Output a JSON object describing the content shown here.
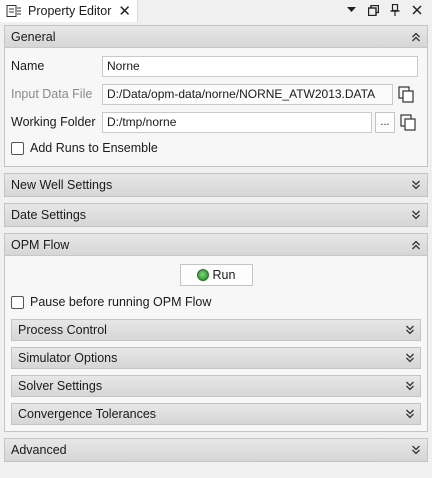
{
  "window": {
    "tab_title": "Property Editor",
    "close_glyph": "✕",
    "icons": [
      "property-editor-icon",
      "tab-close-icon",
      "dropdown-icon",
      "restore-icon",
      "pin-icon",
      "window-close-icon"
    ]
  },
  "sections": {
    "general": {
      "title": "General",
      "name_label": "Name",
      "name_value": "Norne",
      "input_label": "Input Data File",
      "input_value": "D:/Data/opm-data/norne/NORNE_ATW2013.DATA",
      "working_label": "Working Folder",
      "working_value": "D:/tmp/norne",
      "browse_label": "...",
      "add_runs_label": "Add Runs to Ensemble",
      "add_runs_checked": false
    },
    "new_well": {
      "title": "New Well Settings"
    },
    "date": {
      "title": "Date Settings"
    },
    "opm_flow": {
      "title": "OPM Flow",
      "run_label": "Run",
      "pause_label": "Pause before running OPM Flow",
      "pause_checked": false,
      "subsections": [
        "Process Control",
        "Simulator Options",
        "Solver Settings",
        "Convergence Tolerances"
      ]
    },
    "advanced": {
      "title": "Advanced"
    }
  },
  "colors": {
    "header_bg": "#dcdcdc",
    "run_icon": "#3aa43a",
    "border": "#c4c4c4"
  }
}
